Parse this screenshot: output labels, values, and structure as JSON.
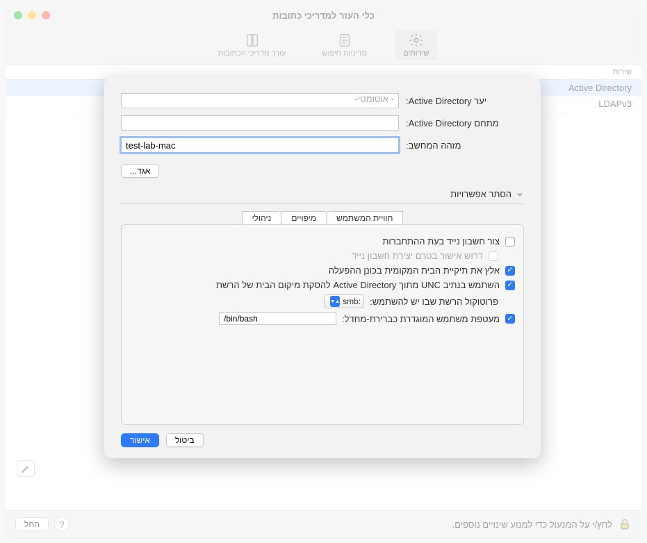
{
  "window": {
    "title": "כלי העזר למדריכי כתובות"
  },
  "toolbar": {
    "tabs": [
      {
        "id": "services",
        "label": "שירותים"
      },
      {
        "id": "search",
        "label": "מדיניות חיפוש"
      },
      {
        "id": "editor",
        "label": "עורך מדריכי הכתובות"
      }
    ]
  },
  "services": {
    "header": "שירות",
    "items": [
      {
        "label": "Active Directory"
      },
      {
        "label": "LDAPv3"
      }
    ]
  },
  "footer": {
    "lock_text": "לחץ/י על המנעול כדי למנוע שינויים נוספים.",
    "apply": "החל"
  },
  "sheet": {
    "forest_label": "יער Active Directory:",
    "forest_placeholder": "- אוטומטי-",
    "domain_label": "מתחם Active Directory:",
    "domain_value": "",
    "computerid_label": "מזהה המחשב:",
    "computerid_value": "test-lab-mac",
    "bind_button": "אגד...",
    "disclosure_label": "הסתר אפשרויות",
    "tabs": {
      "user": "חוויית המשתמש",
      "mappings": "מיפויים",
      "admin": "ניהולי"
    },
    "options": {
      "mobile_account": "צור חשבון נייד בעת ההתחברות",
      "require_confirm": "דרוש אישור בטרם יצירת חשבון נייד",
      "force_local_home": "אלץ את תיקיית הבית המקומית בכונן ההפעלה",
      "use_unc": "השתמש בנתיב UNC מתוך Active Directory להסקת מיקום הבית של הרשת",
      "protocol_label": "פרוטוקול הרשת שבו יש להשתמש:",
      "protocol_value": "smb:",
      "default_shell_label": "מעטפת משתמש המוגדרת כברירת-מחדל:",
      "default_shell_value": "/bin/bash"
    },
    "buttons": {
      "cancel": "ביטול",
      "ok": "אישור"
    }
  }
}
